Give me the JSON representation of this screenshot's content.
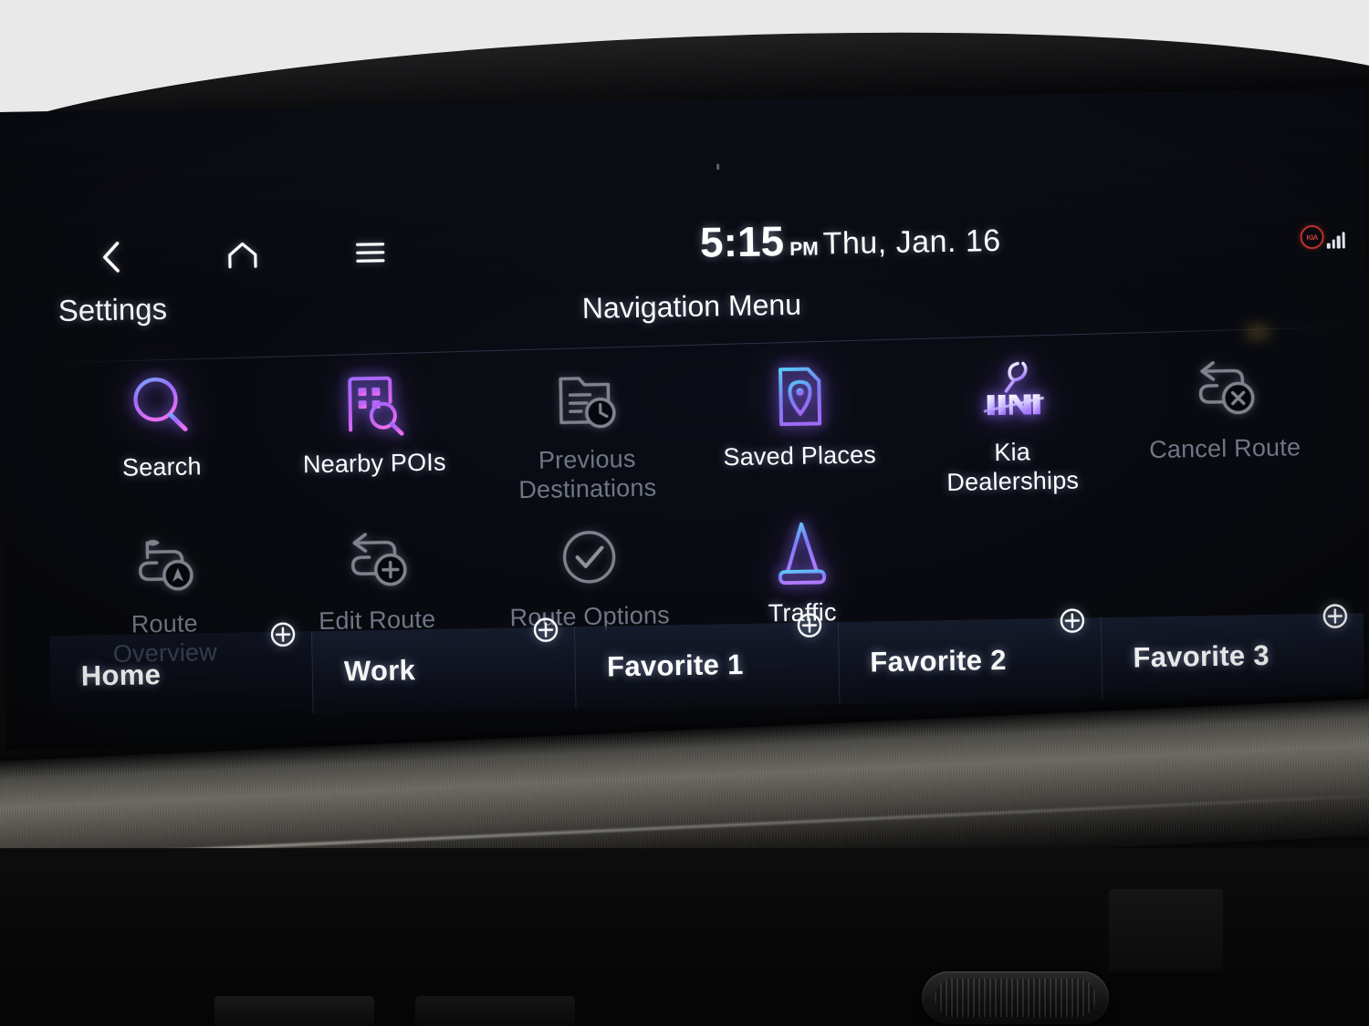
{
  "status": {
    "back_icon": "chevron-left-icon",
    "home_icon": "home-icon",
    "menu_icon": "hamburger-menu-icon",
    "time": "5:15",
    "ampm": "PM",
    "date": "Thu, Jan. 16",
    "connect_badge": "KIA",
    "signal_icon": "signal-bars-icon"
  },
  "header": {
    "settings_label": "Settings",
    "title": "Navigation Menu"
  },
  "grid": {
    "rows": [
      [
        {
          "label": "Search",
          "icon": "search-icon",
          "enabled": true
        },
        {
          "label": "Nearby POIs",
          "icon": "building-search-icon",
          "enabled": true
        },
        {
          "label": "Previous\nDestinations",
          "icon": "history-folder-clock-icon",
          "enabled": false
        },
        {
          "label": "Saved Places",
          "icon": "document-map-pin-icon",
          "enabled": true
        },
        {
          "label": "Kia\nDealerships",
          "icon": "kia-wrench-icon",
          "enabled": true
        },
        {
          "label": "Cancel Route",
          "icon": "route-cancel-icon",
          "enabled": false
        }
      ],
      [
        {
          "label": "Route\nOverview",
          "icon": "route-flag-icon",
          "enabled": false
        },
        {
          "label": "Edit Route",
          "icon": "route-add-icon",
          "enabled": false
        },
        {
          "label": "Route Options",
          "icon": "check-circle-icon",
          "enabled": false
        },
        {
          "label": "Traffic",
          "icon": "traffic-cone-icon",
          "enabled": true
        }
      ]
    ]
  },
  "shortcuts": {
    "add_icon": "plus-circle-icon",
    "items": [
      {
        "label": "Home"
      },
      {
        "label": "Work"
      },
      {
        "label": "Favorite 1"
      },
      {
        "label": "Favorite 2"
      },
      {
        "label": "Favorite 3"
      }
    ]
  },
  "colors": {
    "accent_violet": "#8b5cf6",
    "accent_magenta": "#d86ff0",
    "accent_cyan": "#4cc9f0",
    "disabled": "#6f7684",
    "brand_red": "#c0342e",
    "screen_bg": "#06070a"
  }
}
